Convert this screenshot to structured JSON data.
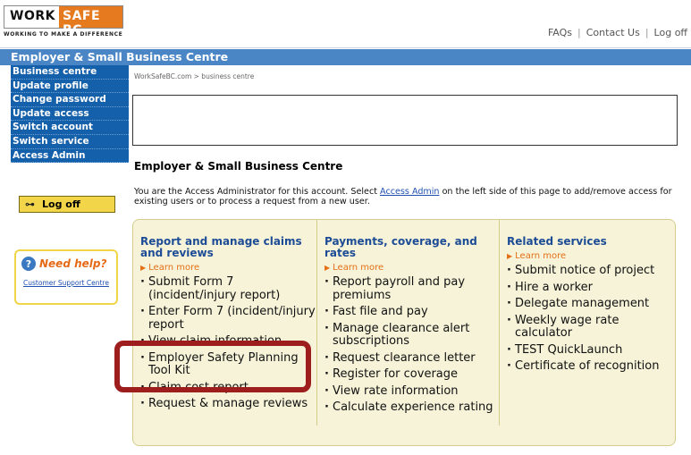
{
  "logo": {
    "work": "WORK",
    "safe": "SAFE BC",
    "tagline": "WORKING TO MAKE A DIFFERENCE"
  },
  "toplinks": [
    "FAQs",
    "Contact Us",
    "Log off"
  ],
  "title_bar": "Employer & Small Business Centre",
  "sidebar": {
    "items": [
      {
        "label": "Business centre"
      },
      {
        "label": "Update profile"
      },
      {
        "label": "Change password"
      },
      {
        "label": "Update access"
      },
      {
        "label": "Switch account"
      },
      {
        "label": "Switch service"
      },
      {
        "label": "Access Admin"
      }
    ],
    "logoff_label": "Log off",
    "help_title": "Need help?",
    "help_link": "Customer Support Centre"
  },
  "breadcrumb": "WorkSafeBC.com > business centre",
  "page_title": "Employer & Small Business Centre",
  "intro": {
    "before": "You are the Access Administrator for this account. Select ",
    "link": "Access Admin",
    "after": " on the left side of this page to add/remove access for existing users or to process a request from a new user."
  },
  "columns": [
    {
      "heading": "Report and manage claims and reviews",
      "learn_more": "Learn more",
      "items": [
        "Submit Form 7 (incident/injury report)",
        "Enter Form 7 (incident/injury report",
        "View claim information",
        "Employer Safety Planning Tool Kit",
        "Claim cost report",
        "Request & manage reviews"
      ]
    },
    {
      "heading": "Payments, coverage, and rates",
      "learn_more": "Learn more",
      "items": [
        "Report payroll and pay premiums",
        "Fast file and pay",
        "Manage clearance alert subscriptions",
        "Request clearance letter",
        "Register for coverage",
        "View rate information",
        "Calculate experience rating"
      ]
    },
    {
      "heading": "Related services",
      "learn_more": "Learn more",
      "items": [
        "Submit notice of project",
        "Hire a worker",
        "Delegate management",
        "Weekly wage rate calculator",
        "TEST QuickLaunch",
        "Certificate of recognition"
      ]
    }
  ],
  "colors": {
    "brand_orange": "#e57a1f",
    "nav_blue": "#1560aa",
    "title_blue": "#4a86c5",
    "panel_bg": "#f6f3d8",
    "highlight_red": "#9e1d1d"
  }
}
